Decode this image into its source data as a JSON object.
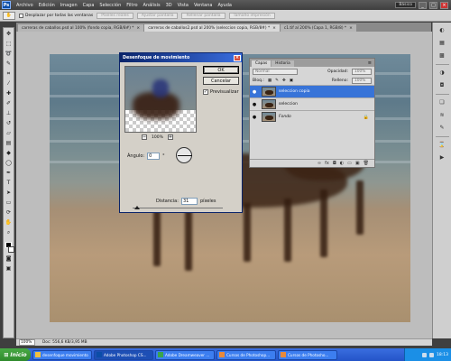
{
  "menubar": {
    "logo": "Ps",
    "items": [
      "Archivo",
      "Edición",
      "Imagen",
      "Capa",
      "Selección",
      "Filtro",
      "Análisis",
      "3D",
      "Vista",
      "Ventana",
      "Ayuda"
    ],
    "workspace": "Básico",
    "win_min": "_",
    "win_max": "□",
    "win_close": "×"
  },
  "options": {
    "preset_icon": "hand-icon",
    "checkbox_label": "Desplazar por todas las ventanas",
    "buttons": [
      "Píxeles reales",
      "Ajustar pantalla",
      "Rellenar pantalla",
      "Tamaño impresión"
    ]
  },
  "tabs": [
    {
      "label": "carreras de caballos.psd al 100% (fondo copia, RGB/8#) *",
      "close": "×",
      "active": false
    },
    {
      "label": "carreras de caballos2.psd al 200% (seleccion copia, RGB/8#) *",
      "close": "×",
      "active": true
    },
    {
      "label": "c1.tif al 200% (Capa 1, RGB/8) *",
      "close": "×",
      "active": false
    }
  ],
  "statusbar": {
    "zoom": "100%",
    "doc": "Doc: 556,6 KB/3,95 MB"
  },
  "dialog": {
    "title": "Desenfoque de movimiento",
    "ok": "OK",
    "cancel": "Cancelar",
    "preview_label": "Previsualizar",
    "preview_checked": "✓",
    "zoom_out": "−",
    "zoom_level": "100%",
    "zoom_in": "+",
    "angle_label": "Ángulo:",
    "angle_value": "0",
    "angle_unit": "°",
    "distance_label": "Distancia:",
    "distance_value": "31",
    "distance_unit": "píxeles"
  },
  "layers_panel": {
    "tabs": [
      "Capas",
      "Historia"
    ],
    "menu": "≡",
    "blend_mode": "Normal",
    "opacity_label": "Opacidad:",
    "opacity_value": "100%",
    "lock_label": "Bloq.:",
    "fill_label": "Relleno:",
    "fill_value": "100%",
    "layers": [
      {
        "name": "seleccion copia",
        "selected": true
      },
      {
        "name": "seleccion",
        "selected": false
      },
      {
        "name": "Fondo",
        "selected": false
      }
    ],
    "eye": "●",
    "lock_icon": "🔒",
    "bottom_icons": [
      "link-icon",
      "fx-icon",
      "mask-icon",
      "adjustment-icon",
      "group-icon",
      "new-layer-icon",
      "trash-icon"
    ],
    "bottom_glyphs": [
      "∞",
      "fx",
      "◘",
      "◐",
      "▭",
      "▣",
      "🗑"
    ]
  },
  "taskbar": {
    "start": "Inicio",
    "tasks": [
      "desenfoque movimiento",
      "Adobe Photoshop CS...",
      "Adobe Dreamweaver ...",
      "Cursos de Photoshop...",
      "Cursos de Photosho..."
    ],
    "clock": "18:13"
  },
  "colors": {
    "selected_layer": "#3874d8",
    "dialog_title": "#0a246a",
    "taskbar": "#2454c8",
    "start": "#2f8a2c"
  }
}
